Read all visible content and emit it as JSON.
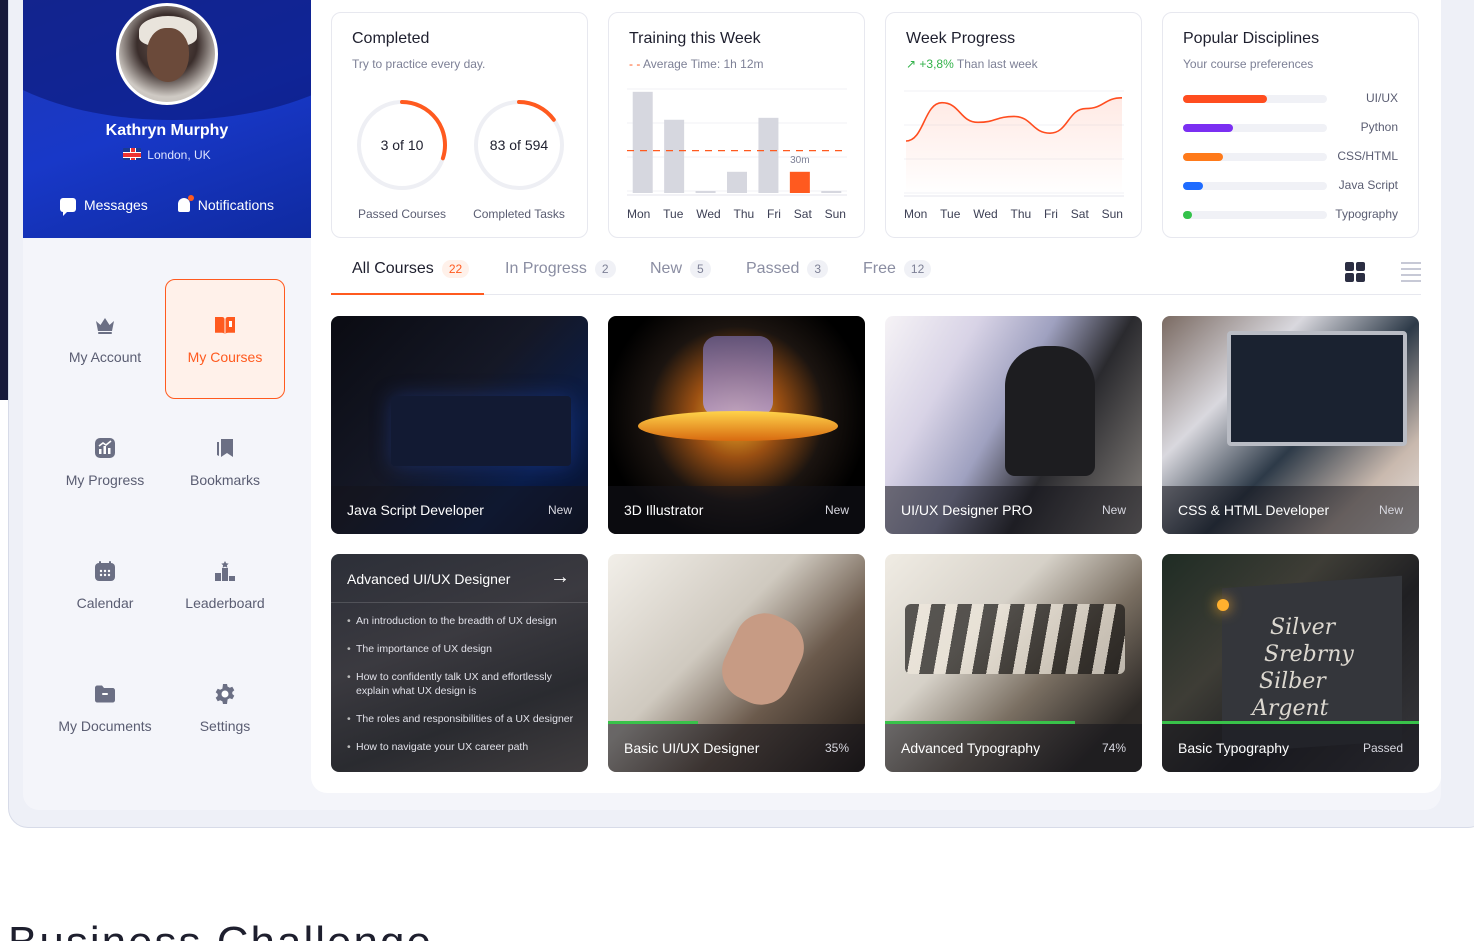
{
  "profile": {
    "name": "Kathryn Murphy",
    "location": "London, UK",
    "messages_label": "Messages",
    "notifications_label": "Notifications"
  },
  "menu": {
    "items": [
      {
        "label": "My Account",
        "icon": "crown-icon"
      },
      {
        "label": "My Courses",
        "icon": "book-open-icon",
        "active": true
      },
      {
        "label": "My Progress",
        "icon": "chart-icon"
      },
      {
        "label": "Bookmarks",
        "icon": "bookmark-icon"
      },
      {
        "label": "Calendar",
        "icon": "calendar-icon"
      },
      {
        "label": "Leaderboard",
        "icon": "podium-icon"
      },
      {
        "label": "My Documents",
        "icon": "folder-icon"
      },
      {
        "label": "Settings",
        "icon": "gear-icon"
      }
    ]
  },
  "cards": {
    "completed": {
      "title": "Completed",
      "subtitle": "Try to practice every day.",
      "rings": [
        {
          "label": "3 of 10",
          "caption": "Passed Courses",
          "value": 3,
          "total": 10
        },
        {
          "label": "83 of 594",
          "caption": "Completed Tasks",
          "value": 83,
          "total": 594
        }
      ]
    },
    "training": {
      "title": "Training this Week",
      "subtitle": "Average Time: 1h 12m",
      "highlight_label": "30m"
    },
    "week_progress": {
      "title": "Week Progress",
      "delta": "+3,8%",
      "delta_text": "Than last week"
    },
    "disciplines": {
      "title": "Popular Disciplines",
      "subtitle": "Your course preferences",
      "items": [
        {
          "label": "UI/UX",
          "value": 0.58,
          "color": "#ff4d1f"
        },
        {
          "label": "Python",
          "value": 0.35,
          "color": "#7b2ff2"
        },
        {
          "label": "CSS/HTML",
          "value": 0.28,
          "color": "#ff7a1a"
        },
        {
          "label": "Java Script",
          "value": 0.14,
          "color": "#1e6bff"
        },
        {
          "label": "Typography",
          "value": 0.06,
          "color": "#33c24a"
        }
      ]
    }
  },
  "chart_data": [
    {
      "type": "bar",
      "title": "Training this Week",
      "categories": [
        "Mon",
        "Tue",
        "Wed",
        "Thu",
        "Fri",
        "Sat",
        "Sun"
      ],
      "values": [
        105,
        76,
        2,
        22,
        78,
        22,
        2
      ],
      "highlight": "Sat",
      "highlight_color": "#ff5a1f",
      "base_color": "#d6d7df",
      "average_line": 44,
      "average_color": "#ff5a1f",
      "ylim": [
        0,
        110
      ]
    },
    {
      "type": "line",
      "title": "Week Progress",
      "categories": [
        "Mon",
        "Tue",
        "Wed",
        "Thu",
        "Fri",
        "Sat",
        "Sun"
      ],
      "values": [
        55,
        94,
        74,
        80,
        63,
        88,
        99
      ],
      "color": "#ff4d1f",
      "ylim": [
        0,
        110
      ]
    }
  ],
  "tabs": [
    {
      "label": "All Courses",
      "count": "22",
      "active": true
    },
    {
      "label": "In Progress",
      "count": "2"
    },
    {
      "label": "New",
      "count": "5"
    },
    {
      "label": "Passed",
      "count": "3"
    },
    {
      "label": "Free",
      "count": "12"
    }
  ],
  "courses": [
    {
      "title": "Java Script Developer",
      "tag": "New"
    },
    {
      "title": "3D Illustrator",
      "tag": "New"
    },
    {
      "title": "UI/UX Designer PRO",
      "tag": "New"
    },
    {
      "title": "CSS & HTML Developer",
      "tag": "New"
    },
    {
      "title": "Advanced UI/UX Designer",
      "tag": "",
      "bullets": [
        "An introduction to the breadth of UX design",
        "The importance of UX design",
        "How to confidently talk UX and effortlessly explain what UX design is",
        "The roles and responsibilities of a UX designer",
        "How to navigate your UX career path"
      ]
    },
    {
      "title": "Basic UI/UX Designer",
      "tag": "35%",
      "progress": 0.35
    },
    {
      "title": "Advanced Typography",
      "tag": "74%",
      "progress": 0.74
    },
    {
      "title": "Basic Typography",
      "tag": "Passed",
      "progress": 1.0
    }
  ],
  "typography_words": [
    "Silver",
    "Srebrny",
    "Silber",
    "Argent"
  ],
  "footer": {
    "text": "Business Challenge"
  }
}
